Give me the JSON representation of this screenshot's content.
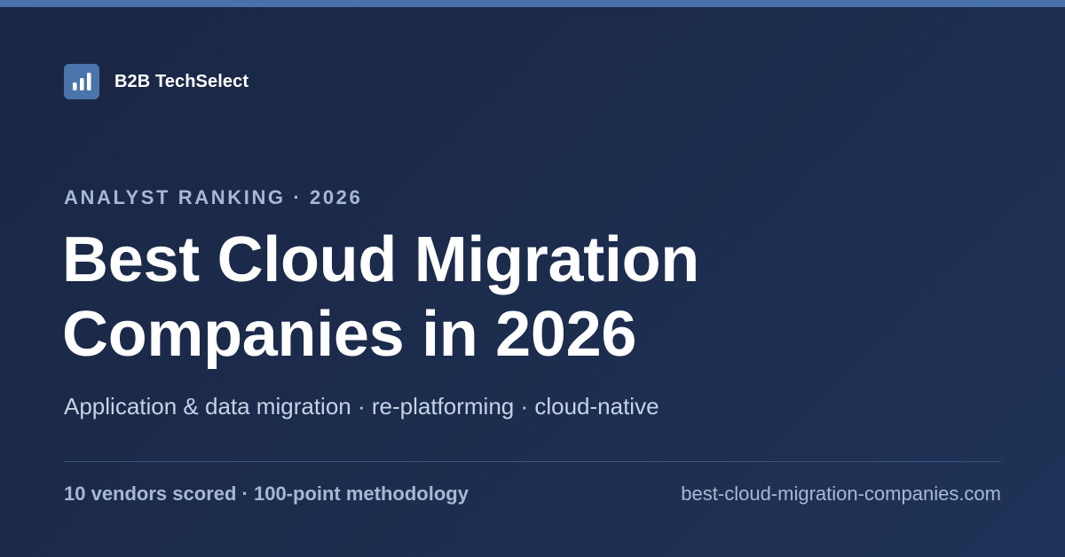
{
  "brand": {
    "logo_icon": "bar-chart-icon",
    "name": "B2B TechSelect"
  },
  "eyebrow": "ANALYST RANKING · 2026",
  "title": {
    "line1": "Best Cloud Migration",
    "line2": "Companies in 2026"
  },
  "subtitle": "Application & data migration · re-platforming · cloud-native",
  "footer": {
    "stats": "10 vendors scored · 100-point methodology",
    "url": "best-cloud-migration-companies.com"
  },
  "colors": {
    "background": "#1c2c4d",
    "accent": "#4b74ad",
    "heading": "#ffffff",
    "muted": "#a7b8d4"
  }
}
